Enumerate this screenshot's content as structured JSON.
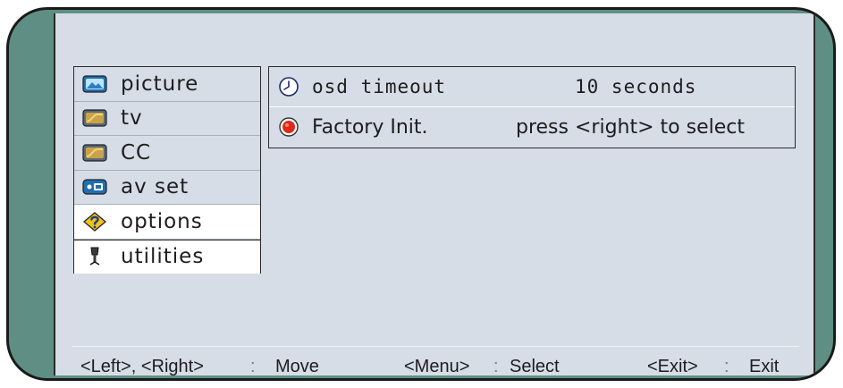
{
  "menu": {
    "items": [
      {
        "label": "picture",
        "icon": "picture-icon",
        "selected": false
      },
      {
        "label": "tv",
        "icon": "tv-icon",
        "selected": false
      },
      {
        "label": "CC",
        "icon": "cc-icon",
        "selected": false
      },
      {
        "label": "av set",
        "icon": "av-set-icon",
        "selected": false
      },
      {
        "label": "options",
        "icon": "options-icon",
        "selected": true
      },
      {
        "label": "utilities",
        "icon": "utilities-icon",
        "selected": true
      }
    ]
  },
  "settings": {
    "rows": [
      {
        "label": "osd timeout",
        "value": "10 seconds",
        "icon": "clock-icon"
      },
      {
        "label": "Factory Init.",
        "value": "press <right> to select",
        "icon": "record-icon"
      }
    ]
  },
  "footer": {
    "move_keys": "<Left>, <Right>",
    "sep1": ":",
    "move_action": "Move",
    "select_key": "<Menu>",
    "sep2": ":",
    "select_action": "Select",
    "exit_key": "<Exit>",
    "sep3": ":",
    "exit_action": "Exit"
  },
  "colors": {
    "bezel": "#5f8f84",
    "screen": "#d6dde7",
    "selected_bg": "#ffffff"
  }
}
